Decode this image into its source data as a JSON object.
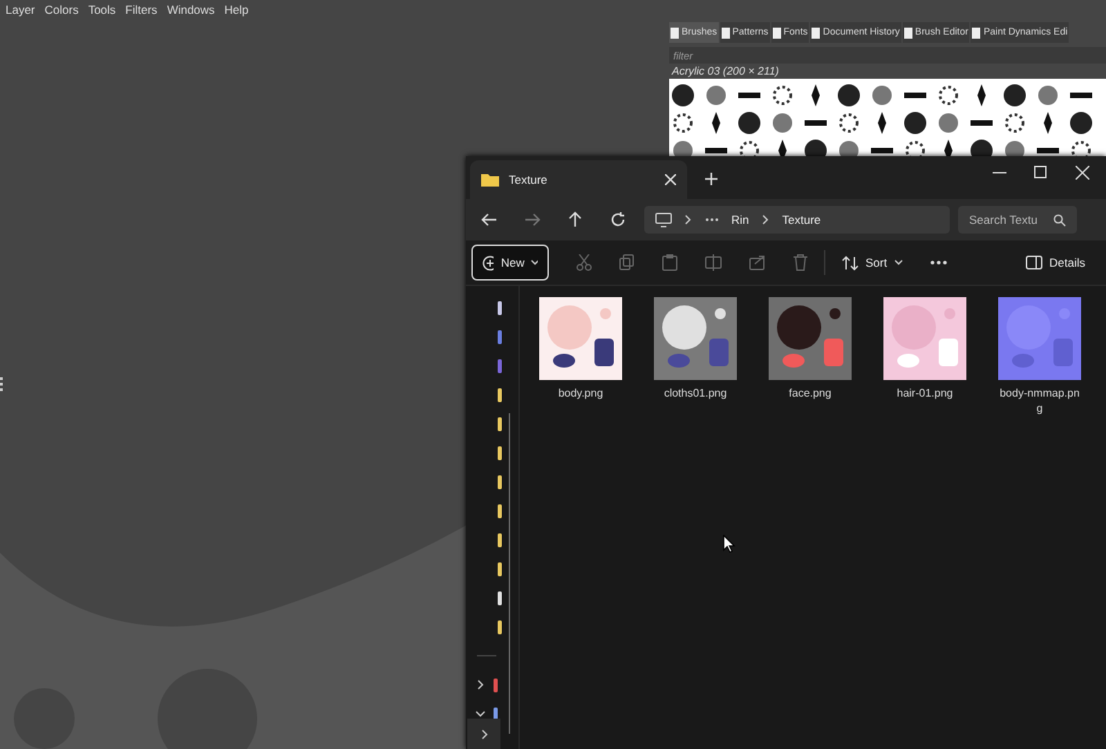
{
  "menu": [
    "Layer",
    "Colors",
    "Tools",
    "Filters",
    "Windows",
    "Help"
  ],
  "dock": {
    "tabs": [
      {
        "label": "Brushes",
        "selected": true
      },
      {
        "label": "Patterns",
        "selected": false
      },
      {
        "label": "Fonts",
        "selected": false
      },
      {
        "label": "Document History",
        "selected": false
      },
      {
        "label": "Brush Editor",
        "selected": false
      },
      {
        "label": "Paint Dynamics Edi",
        "selected": false
      }
    ],
    "filter": {
      "placeholder": "filter"
    },
    "brush_name": "Acrylic 03 (200 × 211)"
  },
  "explorer": {
    "tab": "Texture",
    "crumbs": [
      "Rin",
      "Texture"
    ],
    "search": {
      "placeholder": "Search Textu"
    },
    "toolbar": {
      "new": "New",
      "sort": "Sort",
      "details": "Details"
    },
    "nav": [
      {
        "color": "#c8c8e8"
      },
      {
        "color": "#6a7ee0"
      },
      {
        "color": "#7a66d8"
      },
      {
        "color": "#e8c860"
      },
      {
        "color": "#e8c860"
      },
      {
        "color": "#e8c860"
      },
      {
        "color": "#e8c860"
      },
      {
        "color": "#e8c860"
      },
      {
        "color": "#e8c860"
      },
      {
        "color": "#e8c860"
      },
      {
        "color": "#e0e0e0"
      },
      {
        "color": "#e8c860"
      }
    ],
    "tree": [
      {
        "color": "#e05050",
        "expanded": false
      },
      {
        "color": "#7a9ae8",
        "expanded": true
      }
    ],
    "files": [
      {
        "name": "body.png",
        "kind": "picture"
      },
      {
        "name": "cloths01.png",
        "kind": "picture"
      },
      {
        "name": "face.png",
        "kind": "picture"
      },
      {
        "name": "hair-01.png",
        "kind": "picture"
      },
      {
        "name": "body-nmmap.png",
        "kind": "picture"
      }
    ]
  }
}
